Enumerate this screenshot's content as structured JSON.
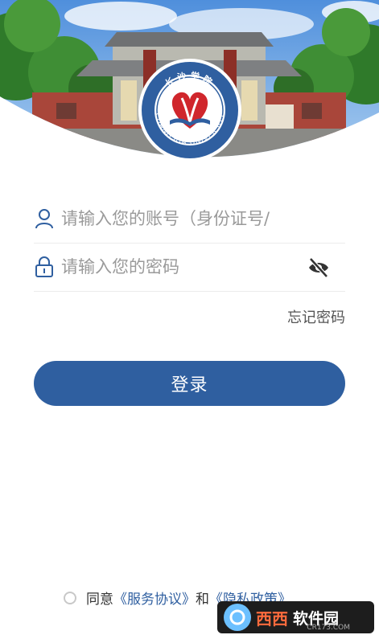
{
  "header": {
    "logo": {
      "seal_text": "长沙学院",
      "english_name": "CHANGSHA UNIVERSITY",
      "gate_plaque": "长沙学院"
    }
  },
  "login": {
    "account_placeholder": "请输入您的账号（身份证号/",
    "password_placeholder": "请输入您的密码",
    "forgot_label": "忘记密码",
    "submit_label": "登录"
  },
  "agreement": {
    "prefix": "同意",
    "service_link": "《服务协议》",
    "conjunction": "和",
    "privacy_link": "《隐私政策》"
  },
  "watermark": {
    "brand": "西西",
    "name": "软件园",
    "domain": "CR173.COM"
  },
  "icons": {
    "account": "user-icon",
    "password": "lock-icon",
    "visibility": "eye-off-icon"
  },
  "colors": {
    "primary": "#2f5fa0",
    "seal_red": "#d0262c"
  }
}
